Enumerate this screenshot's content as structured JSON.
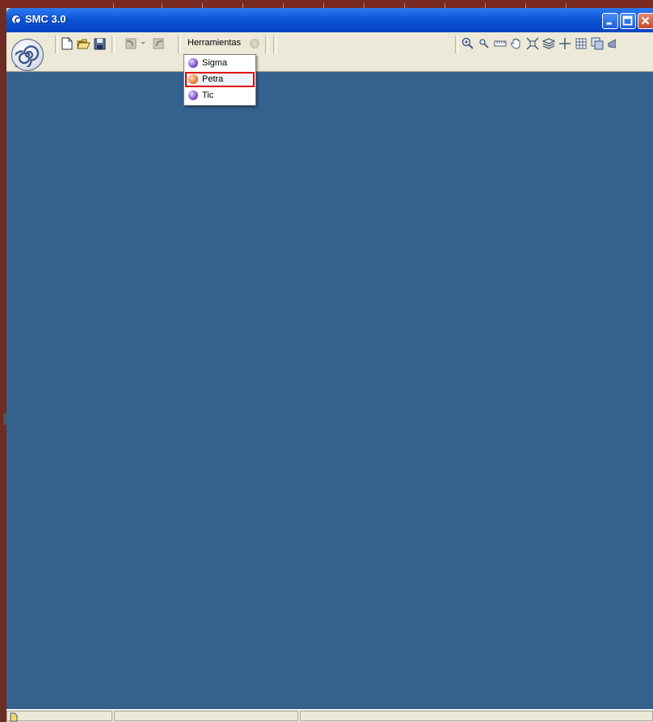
{
  "window": {
    "title": "SMC 3.0",
    "controls": [
      "minimize-icon",
      "maximize-icon",
      "close-icon"
    ]
  },
  "toolbar": {
    "file_buttons": [
      "new-file-icon",
      "open-folder-icon",
      "save-icon"
    ],
    "edit_buttons": [
      "undo-icon",
      "redo-icon"
    ],
    "menu_label": "Herramientas",
    "map_tools": [
      "zoom-in-icon",
      "zoom-out-icon",
      "measure-icon",
      "pan-hand-icon",
      "full-extent-icon",
      "layers-icon",
      "crosshair-icon",
      "grid-icon",
      "copy-map-icon",
      "eraser-icon"
    ]
  },
  "dropdown": {
    "items": [
      {
        "label": "Sigma",
        "color": "#7b4fd0"
      },
      {
        "label": "Petra",
        "color": "#f07a2a",
        "selected": true
      },
      {
        "label": "Tic",
        "color": "#7b4fd0"
      }
    ]
  },
  "colors": {
    "canvas": "#35618e",
    "titlebar": "#0a52d6",
    "highlight": "#e00000"
  }
}
